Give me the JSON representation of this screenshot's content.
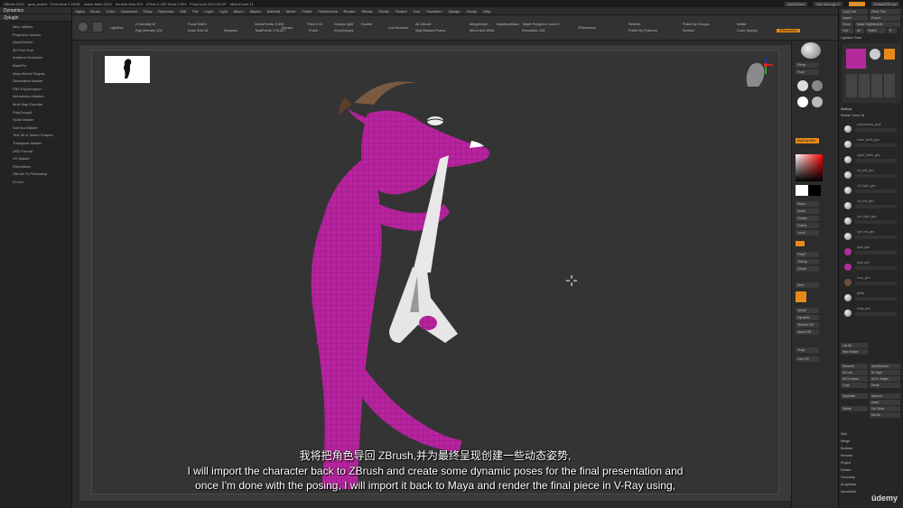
{
  "titlebar": {
    "items": [
      "ZBrush 2023",
      "goat_posed",
      "Free Mem 2.20GB",
      "Active Mem 2243",
      "Scratch Disk 913",
      "ZTime 0.403 Timer 0.003",
      "PolyCount 400.316 KP",
      "MeshCount 11"
    ],
    "quicksave": "QuickSave",
    "seethrough": "See-through 0",
    "menus": "Menus",
    "defaultscript": "DefaultZScript"
  },
  "left_panel": {
    "tabs": [
      "Dynamics",
      "Zplugin"
    ],
    "items": [
      "Misc Utilities",
      "Projection Master",
      "QuickSketch",
      "3D Print Hub",
      "Ambient Occlusion",
      "Decimation Master",
      "FBX ExportImport",
      "Intersection Masker",
      "Multi Map Exporter",
      "PolyGroupIt",
      "Scale Master",
      "SubTool Master",
      "Text 3D & Vector Shapes",
      "Transpose Master",
      "USD Format",
      "UV Master",
      "ZBrush To Photoshop",
      "ZColor"
    ],
    "extra": [
      "BasePro",
      "Maya Blend Shapes",
      "ZRemMark"
    ]
  },
  "menubar": [
    "Alpha",
    "Brush",
    "Color",
    "Document",
    "Draw",
    "Dynamics",
    "Edit",
    "File",
    "Layer",
    "Light",
    "Macro",
    "Marker",
    "Material",
    "Movie",
    "Picker",
    "Preferences",
    "Render",
    "Stencil",
    "Stroke",
    "Texture",
    "Tool",
    "Transform",
    "Zplugin",
    "Zscript",
    "Help"
  ],
  "toolbar": {
    "lightbox": "LightBox",
    "z_intensity": "Z Intensity 67",
    "rgb_intensity": "Rgb Intensity 100",
    "focal_shift": "Focal Shift 0",
    "draw_size": "Draw Size 64",
    "dynamic": "Dynamic",
    "active_points": "ActivePoints: 9,495",
    "total_points": "TotalPoints: 276,027",
    "extract": "Extract",
    "thick": "Thick 0.02",
    "polish": "Polish",
    "double": "Double",
    "group_split": "Groups Split",
    "keep_groups": "KeepGroups",
    "live_boolean": "Live Boolean",
    "all_zbrush": "All ZBrush",
    "split_masked": "Split Masked Points",
    "merge_down": "MergeDown",
    "backface": "BackfaceMask",
    "mirror_weld": "Mirror And Weld",
    "target_polygons": "Target Polygons Count 5",
    "resolution": "Resolution 128",
    "zremesher": "ZRemesher",
    "refresh": "Refresh",
    "polish_features": "Polish By Features",
    "polish_groups": "Polish By Groups",
    "inflate": "Inflate",
    "surface": "Surface",
    "groups": "Groups",
    "color_opacity": "Color Opacity",
    "zremesher_btn": "ZRemesher"
  },
  "viewport": {
    "subtitle_cn": "我将把角色导回 ZBrush,并为最终呈现创建一些动态姿势,",
    "subtitle_en1": "I will import the character back to ZBrush and create some dynamic poses for the final presentation and",
    "subtitle_en2": "once I'm done with the posing, I will import it back to Maya and render the final piece in V-Ray using,"
  },
  "vtools": {
    "buttons": [
      "Move",
      "Scale",
      "Rotate",
      "Frame",
      "Local",
      "Floor",
      "PolyF",
      "Transp",
      "Ghost",
      "Solo",
      "Xpose",
      "Dynamic",
      "Persp",
      "Snap",
      "Line Fill"
    ],
    "material": "MatCap Red",
    "texture": "Texture Off",
    "alpha": "Alpha Off"
  },
  "right_panel": {
    "header": [
      "Copy Tool",
      "Paste Tool",
      "Import",
      "Export",
      "Clone",
      "Make PolyMesh3D",
      "GoZ",
      "All",
      "Visible",
      "R",
      "Lightbox Tools"
    ],
    "tool_name": "goat_posed: 48",
    "subtool_header": "Subtool",
    "visible_count": "Visible Count 16",
    "subtools": [
      "expressions_goat",
      "lower_teeth_geo",
      "upper_teeth_geo",
      "Lid_left_geo",
      "Lid_right_geo",
      "Lid_left_geo",
      "eye_right_geo",
      "eye_left_geo",
      "goat_geo",
      "goat_geo",
      "horn_geo",
      "guitar",
      "strap_geo",
      "strap_geo1",
      "strap_geo"
    ],
    "buttons": [
      "List All",
      "New Folder",
      "Rename",
      "AutoReorder",
      "All Low",
      "All High",
      "All To Home",
      "All To Target",
      "Copy",
      "Paste",
      "Duplicate",
      "Append",
      "Insert",
      "Delete",
      "Del Other",
      "Del All",
      "Split",
      "Merge",
      "Boolean",
      "Remesh",
      "Project",
      "Extract",
      "Geometry",
      "ArrayMesh",
      "NanoMesh",
      "Layers",
      "FiberMesh",
      "Geometry HD",
      "Preview",
      "Surface",
      "Deformation",
      "Masking"
    ]
  },
  "colors": {
    "accent": "#e88a1a",
    "goat_body": "#c02aa8",
    "panel": "#262626",
    "viewport_bg": "#343434"
  },
  "watermark": "ûdemy"
}
